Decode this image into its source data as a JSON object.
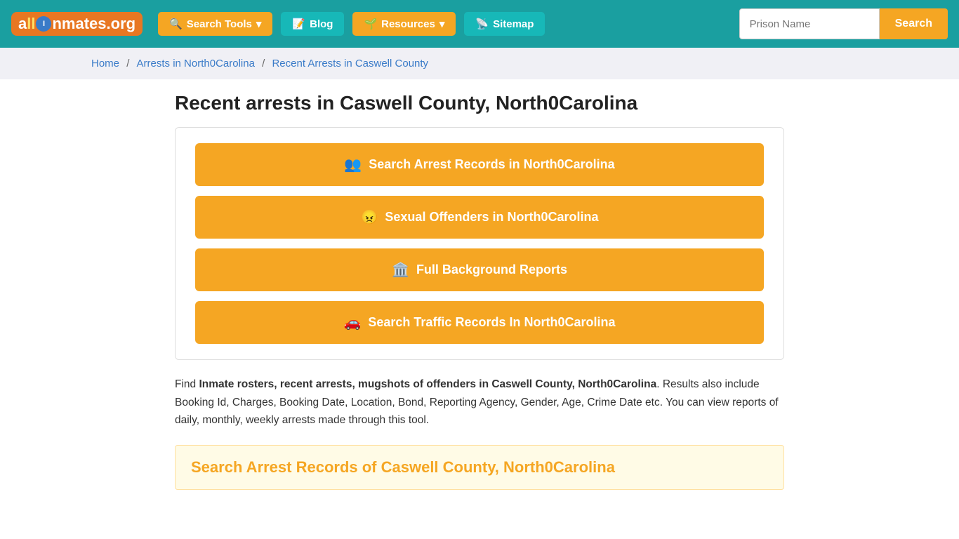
{
  "header": {
    "logo_text": "allInmates.org",
    "nav_items": [
      {
        "id": "search-tools",
        "label": "Search Tools",
        "icon": "🔍",
        "has_dropdown": true
      },
      {
        "id": "blog",
        "label": "Blog",
        "icon": "📝",
        "has_dropdown": false
      },
      {
        "id": "resources",
        "label": "Resources",
        "icon": "🌱",
        "has_dropdown": true
      },
      {
        "id": "sitemap",
        "label": "Sitemap",
        "icon": "📡",
        "has_dropdown": false
      }
    ],
    "prison_name_placeholder": "Prison Name",
    "search_btn_label": "Search"
  },
  "breadcrumb": {
    "home": "Home",
    "arrests": "Arrests in North0Carolina",
    "current": "Recent Arrests in Caswell County"
  },
  "page": {
    "title": "Recent arrests in Caswell County, North0Carolina",
    "buttons": [
      {
        "id": "arrest-records",
        "icon": "👥",
        "label": "Search Arrest Records in North0Carolina"
      },
      {
        "id": "sexual-offenders",
        "icon": "😠",
        "label": "Sexual Offenders in North0Carolina"
      },
      {
        "id": "background-reports",
        "icon": "🏛️",
        "label": "Full Background Reports"
      },
      {
        "id": "traffic-records",
        "icon": "🚗",
        "label": "Search Traffic Records In North0Carolina"
      }
    ],
    "description_prefix": "Find ",
    "description_bold": "Inmate rosters, recent arrests, mugshots of offenders in Caswell County, North0Carolina",
    "description_rest": ". Results also include Booking Id, Charges, Booking Date, Location, Bond, Reporting Agency, Gender, Age, Crime Date etc. You can view reports of daily, monthly, weekly arrests made through this tool.",
    "cta_title": "Search Arrest Records of Caswell County, North0Carolina"
  }
}
